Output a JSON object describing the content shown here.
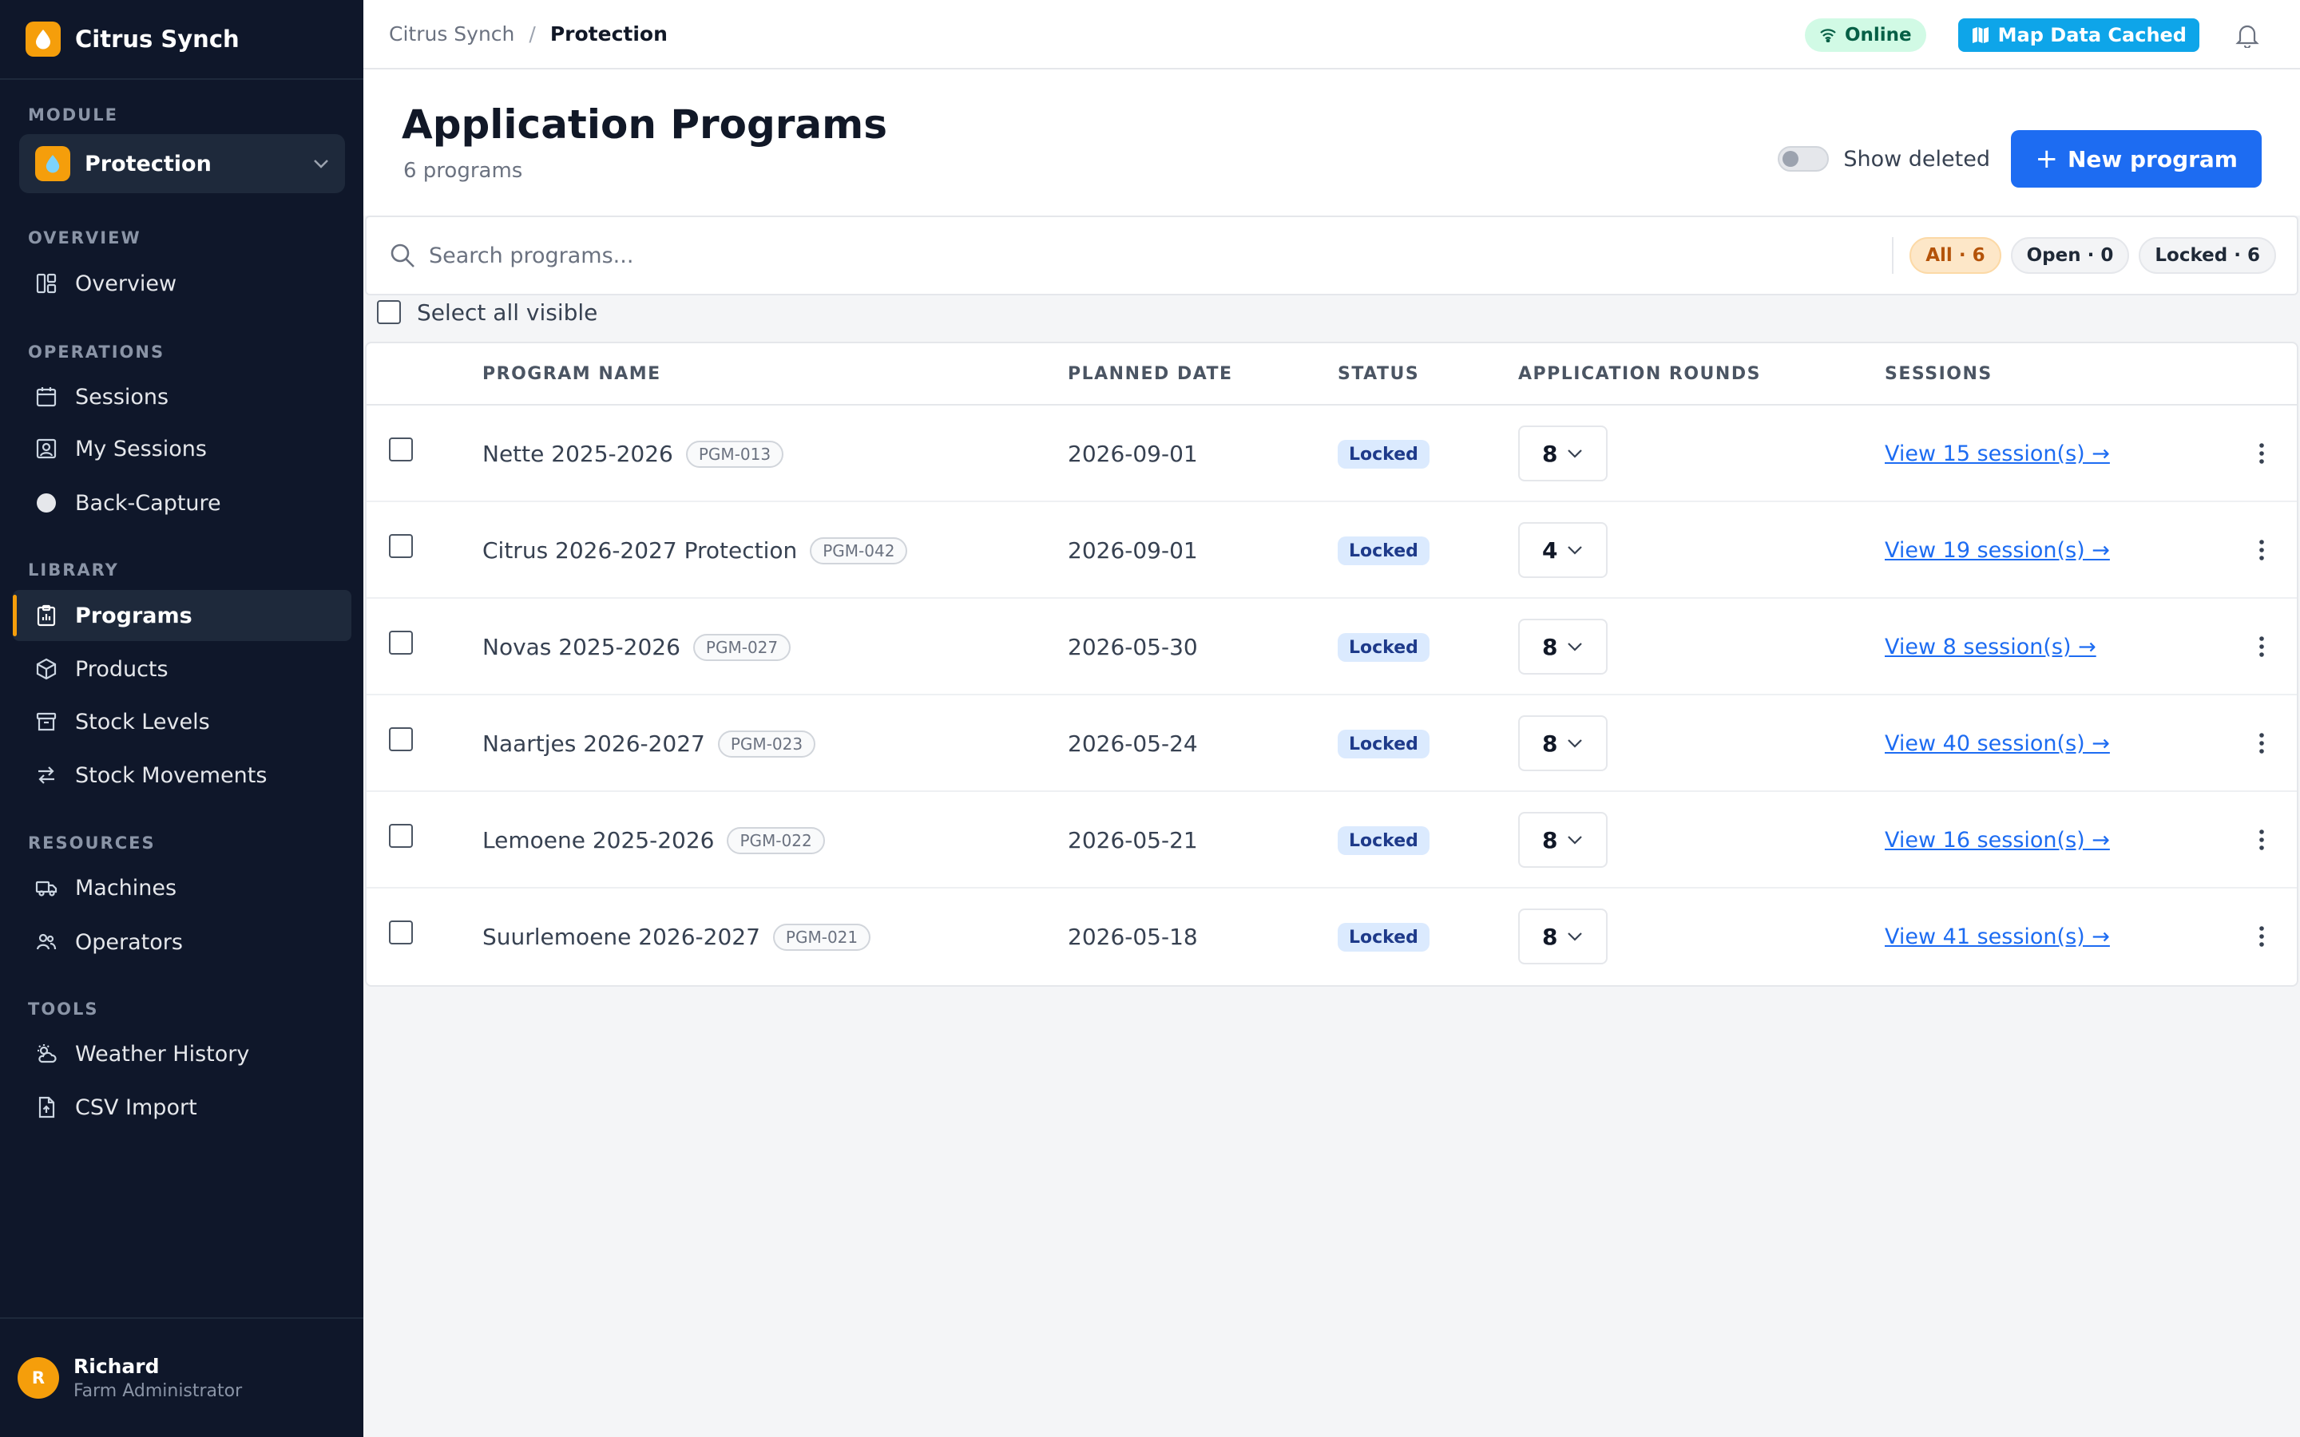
{
  "brand": {
    "name": "Citrus Synch",
    "accent": "#f59e0b"
  },
  "sidebar": {
    "module_label": "MODULE",
    "module": "Protection",
    "sections": {
      "overview": "OVERVIEW",
      "operations": "OPERATIONS",
      "library": "LIBRARY",
      "resources": "RESOURCES",
      "tools": "TOOLS"
    },
    "items": {
      "overview": "Overview",
      "sessions": "Sessions",
      "my_sessions": "My Sessions",
      "back_capture": "Back-Capture",
      "programs": "Programs",
      "products": "Products",
      "stock_levels": "Stock Levels",
      "stock_movements": "Stock Movements",
      "machines": "Machines",
      "operators": "Operators",
      "weather_history": "Weather History",
      "csv_import": "CSV Import"
    },
    "active_item": "Programs"
  },
  "user": {
    "initial": "R",
    "name": "Richard",
    "role": "Farm Administrator"
  },
  "topbar": {
    "breadcrumb": [
      "Citrus Synch",
      "Protection"
    ],
    "separator": "/",
    "online": "Online",
    "map_cached": "Map Data Cached"
  },
  "header": {
    "title": "Application Programs",
    "subtitle": "6 programs",
    "show_deleted": "Show deleted",
    "new_plus": "+",
    "new_program": "New program"
  },
  "search": {
    "placeholder": "Search programs..."
  },
  "filters": [
    {
      "label": "All",
      "count": "6",
      "active": true
    },
    {
      "label": "Open",
      "count": "0",
      "active": false
    },
    {
      "label": "Locked",
      "count": "6",
      "active": false
    }
  ],
  "select_all": "Select all visible",
  "table": {
    "columns": [
      "PROGRAM NAME",
      "PLANNED DATE",
      "STATUS",
      "APPLICATION ROUNDS",
      "SESSIONS"
    ],
    "rows": [
      {
        "name": "Nette 2025-2026",
        "code": "PGM-013",
        "date": "2026-09-01",
        "status": "Locked",
        "rounds": "8",
        "sessions": "View 15 session(s) →"
      },
      {
        "name": "Citrus 2026-2027 Protection",
        "code": "PGM-042",
        "date": "2026-09-01",
        "status": "Locked",
        "rounds": "4",
        "sessions": "View 19 session(s) →"
      },
      {
        "name": "Novas 2025-2026",
        "code": "PGM-027",
        "date": "2026-05-30",
        "status": "Locked",
        "rounds": "8",
        "sessions": "View 8 session(s) →"
      },
      {
        "name": "Naartjes 2026-2027",
        "code": "PGM-023",
        "date": "2026-05-24",
        "status": "Locked",
        "rounds": "8",
        "sessions": "View 40 session(s) →"
      },
      {
        "name": "Lemoene 2025-2026",
        "code": "PGM-022",
        "date": "2026-05-21",
        "status": "Locked",
        "rounds": "8",
        "sessions": "View 16 session(s) →"
      },
      {
        "name": "Suurlemoene 2026-2027",
        "code": "PGM-021",
        "date": "2026-05-18",
        "status": "Locked",
        "rounds": "8",
        "sessions": "View 41 session(s) →"
      }
    ]
  }
}
